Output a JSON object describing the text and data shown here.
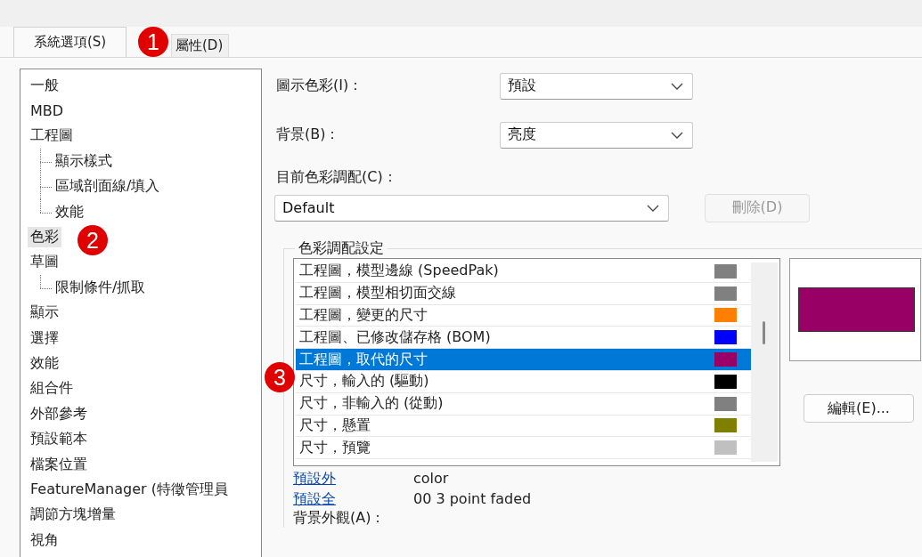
{
  "tabs": [
    {
      "label": "系統選項(S)",
      "selected": true
    },
    {
      "label": "屬性(D)",
      "selected": false
    }
  ],
  "tree": [
    {
      "label": "一般",
      "selected": false
    },
    {
      "label": "MBD",
      "selected": false
    },
    {
      "label": "工程圖",
      "selected": false,
      "children": [
        {
          "label": "顯示樣式",
          "selected": false
        },
        {
          "label": "區域剖面線/填入",
          "selected": false
        },
        {
          "label": "效能",
          "selected": false
        }
      ]
    },
    {
      "label": "色彩",
      "selected": true
    },
    {
      "label": "草圖",
      "selected": false,
      "children": [
        {
          "label": "限制條件/抓取",
          "selected": false
        }
      ]
    },
    {
      "label": "顯示",
      "selected": false
    },
    {
      "label": "選擇",
      "selected": false
    },
    {
      "label": "效能",
      "selected": false
    },
    {
      "label": "組合件",
      "selected": false
    },
    {
      "label": "外部參考",
      "selected": false
    },
    {
      "label": "預設範本",
      "selected": false
    },
    {
      "label": "檔案位置",
      "selected": false
    },
    {
      "label": "FeatureManager (特徵管理員",
      "selected": false
    },
    {
      "label": "調節方塊增量",
      "selected": false
    },
    {
      "label": "視角",
      "selected": false
    }
  ],
  "icon_colors": {
    "label": "圖示色彩(I)：",
    "value": "預設"
  },
  "background": {
    "label": "背景(B)：",
    "value": "亮度"
  },
  "current_scheme": {
    "label": "目前色彩調配(C)：",
    "value": "Default",
    "delete_button": {
      "label": "刪除(D)",
      "disabled": true
    }
  },
  "scheme_settings": {
    "title": "色彩調配設定",
    "items": [
      {
        "label": "工程圖，模型邊線 (SpeedPak)",
        "color": "#808080",
        "selected": false
      },
      {
        "label": "工程圖，模型相切面交線",
        "color": "#808080",
        "selected": false
      },
      {
        "label": "工程圖，變更的尺寸",
        "color": "#ff8000",
        "selected": false
      },
      {
        "label": "工程圖、已修改儲存格 (BOM)",
        "color": "#0000ff",
        "selected": false
      },
      {
        "label": "工程圖，取代的尺寸",
        "color": "#990066",
        "selected": true
      },
      {
        "label": "尺寸，輸入的 (驅動)",
        "color": "#000000",
        "selected": false
      },
      {
        "label": "尺寸，非輸入的 (從動)",
        "color": "#808080",
        "selected": false
      },
      {
        "label": "尺寸，懸置",
        "color": "#808000",
        "selected": false
      },
      {
        "label": "尺寸，預覽",
        "color": "#c0c0c0",
        "selected": false
      }
    ],
    "edit_button": "編輯(E)..."
  },
  "defaults": [
    {
      "link": "預設外",
      "value": "color"
    },
    {
      "link": "預設全",
      "value": "00 3 point faded"
    }
  ],
  "background_appearance": {
    "label": "背景外觀(A)："
  },
  "annotations": [
    {
      "label": "1"
    },
    {
      "label": "2"
    },
    {
      "label": "3"
    }
  ]
}
